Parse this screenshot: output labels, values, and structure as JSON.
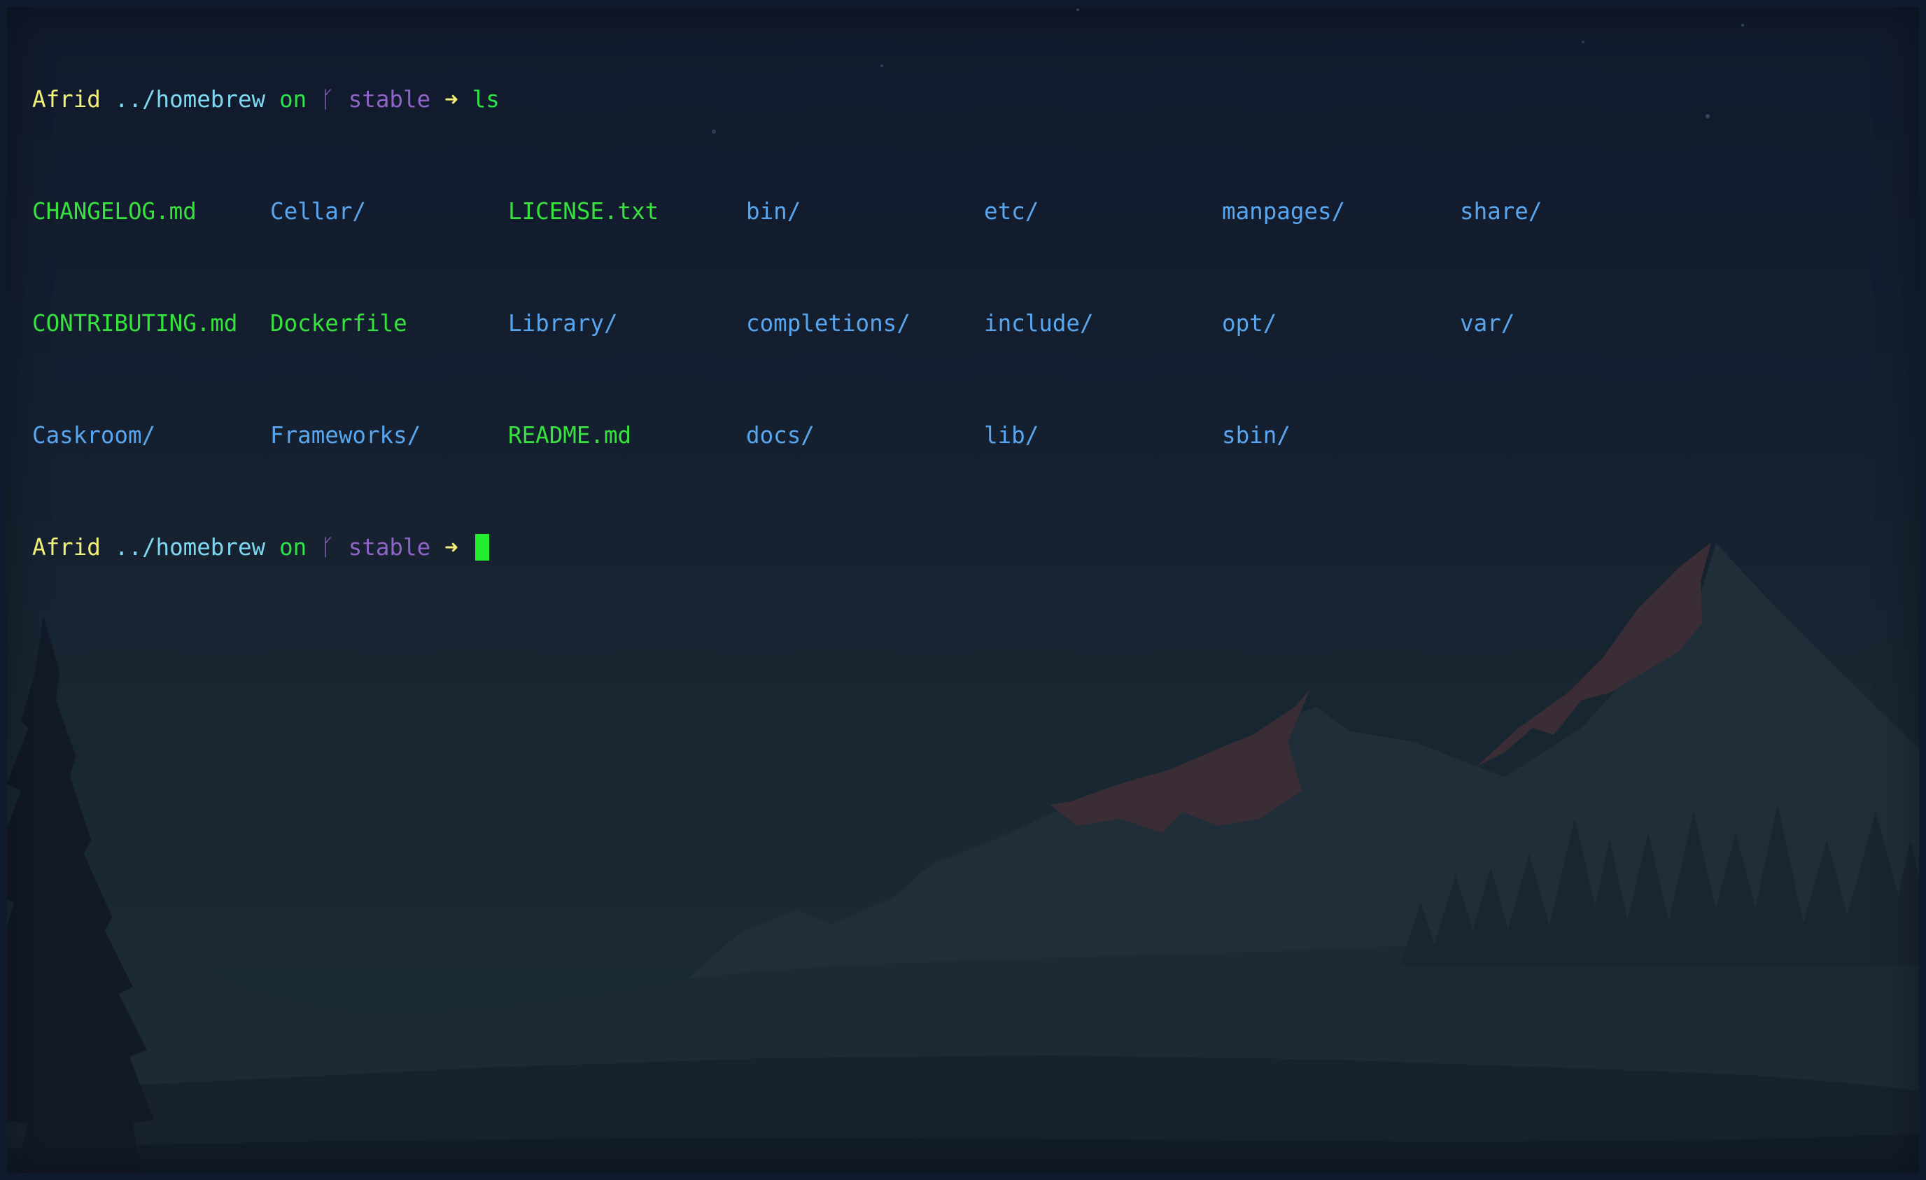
{
  "prompt": {
    "user": "Afrid",
    "path": "../homebrew",
    "on": "on",
    "branch_icon": "ᚴ",
    "branch": "stable",
    "arrow": "➜"
  },
  "command": "ls",
  "listing": {
    "rows": [
      [
        "CHANGELOG.md",
        "Cellar/",
        "LICENSE.txt",
        "bin/",
        "etc/",
        "manpages/",
        "share/"
      ],
      [
        "CONTRIBUTING.md",
        "Dockerfile",
        "Library/",
        "completions/",
        "include/",
        "opt/",
        "var/"
      ],
      [
        "Caskroom/",
        "Frameworks/",
        "README.md",
        "docs/",
        "lib/",
        "sbin/",
        ""
      ]
    ]
  },
  "colors": {
    "user": "#f3f07a",
    "path": "#7fd8f0",
    "on": "#2fe24a",
    "branch": "#8f63c8",
    "file": "#37e23e",
    "directory": "#5aa6ee",
    "cursor": "#23ee2f"
  }
}
